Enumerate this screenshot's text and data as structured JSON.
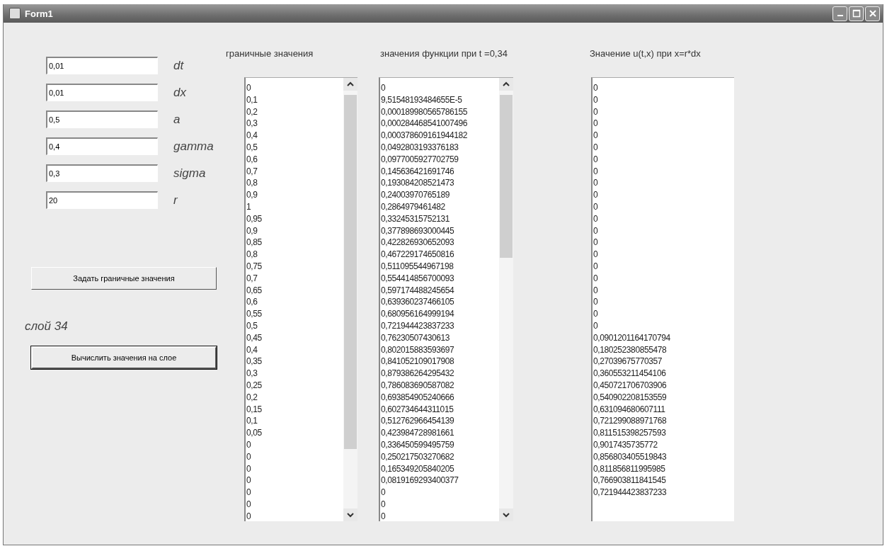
{
  "window": {
    "title": "Form1"
  },
  "parameters": [
    {
      "value": "0,01",
      "label": "dt"
    },
    {
      "value": "0,01",
      "label": "dx"
    },
    {
      "value": "0,5",
      "label": "a"
    },
    {
      "value": "0,4",
      "label": "gamma"
    },
    {
      "value": "0,3",
      "label": "sigma"
    },
    {
      "value": "20",
      "label": "r"
    }
  ],
  "buttons": [
    {
      "label": "Задать граничные значения",
      "default": false
    },
    {
      "label": "Вычислить значения на слое",
      "default": true
    }
  ],
  "layer_label": "слой 34",
  "lists": [
    {
      "title": "граничные значения",
      "scrollbar": true,
      "items": [
        "0",
        "0,1",
        "0,2",
        "0,3",
        "0,4",
        "0,5",
        "0,6",
        "0,7",
        "0,8",
        "0,9",
        "1",
        "0,95",
        "0,9",
        "0,85",
        "0,8",
        "0,75",
        "0,7",
        "0,65",
        "0,6",
        "0,55",
        "0,5",
        "0,45",
        "0,4",
        "0,35",
        "0,3",
        "0,25",
        "0,2",
        "0,15",
        "0,1",
        "0,05",
        "0",
        "0",
        "0",
        "0",
        "0",
        "0",
        "0"
      ]
    },
    {
      "title": "значения функции при t =0,34",
      "scrollbar": true,
      "items": [
        "0",
        "9,51548193484655E-5",
        "0,000189980565786155",
        "0,000284468541007496",
        "0,000378609161944182",
        "0,0492803193376183",
        "0,0977005927702759",
        "0,145636421691746",
        "0,193084208521473",
        "0,24003970765189",
        "0,2864979461482",
        "0,33245315752131",
        "0,377898693000445",
        "0,422826930652093",
        "0,467229174650816",
        "0,511095544967198",
        "0,554414856700093",
        "0,597174488245654",
        "0,639360237466105",
        "0,680956164999194",
        "0,721944423837233",
        "0,76230507430613",
        "0,802015883593697",
        "0,841052109017908",
        "0,879386264295432",
        "0,786083690587082",
        "0,693854905240666",
        "0,602734644311015",
        "0,512762966454139",
        "0,423984728981661",
        "0,336450599495759",
        "0,250217503270682",
        "0,165349205840205",
        "0,0819169293400377",
        "0",
        "0",
        "0"
      ]
    },
    {
      "title": "Значение u(t,x) при x=r*dx",
      "scrollbar": false,
      "items": [
        "0",
        "0",
        "0",
        "0",
        "0",
        "0",
        "0",
        "0",
        "0",
        "0",
        "0",
        "0",
        "0",
        "0",
        "0",
        "0",
        "0",
        "0",
        "0",
        "0",
        "0",
        "0,0901201164170794",
        "0,180252380855478",
        "0,27039675770357",
        "0,360553211454106",
        "0,450721706703906",
        "0,540902208153559",
        "0,631094680607111",
        "0,721299088971768",
        "0,811515398257593",
        "0,9017435735772",
        "0,856803405519843",
        "0,811856811995985",
        "0,766903811841545",
        "0,721944423837233"
      ]
    }
  ]
}
